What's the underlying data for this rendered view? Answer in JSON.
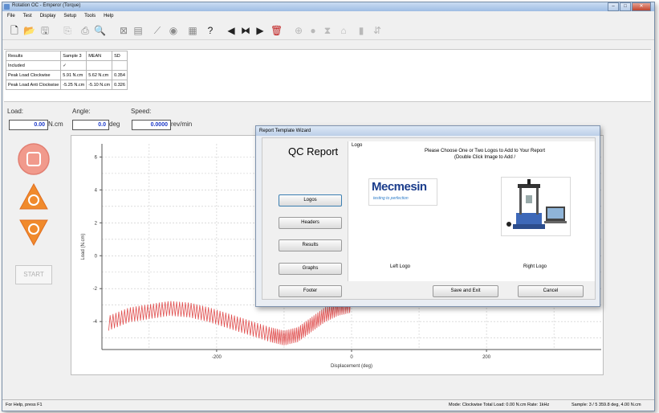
{
  "window": {
    "title": "Rotation OC - Emperor (Torque)",
    "controls": [
      "–",
      "□",
      "✕"
    ]
  },
  "menu": [
    "File",
    "Test",
    "Display",
    "Setup",
    "Tools",
    "Help"
  ],
  "results_table": {
    "headers": [
      "Results",
      "Sample 3",
      "MEAN",
      "SD"
    ],
    "rows": [
      [
        "Included",
        "✓",
        "",
        ""
      ],
      [
        "Peak Load Clockwise",
        "5.91 N.cm",
        "5.62 N.cm",
        "0.354"
      ],
      [
        "Peak Load Anti Clockwise",
        "-5.25 N.cm",
        "-5.10 N.cm",
        "0.326"
      ]
    ]
  },
  "readouts": {
    "load": {
      "label": "Load:",
      "value": "0.00",
      "unit": "N.cm"
    },
    "angle": {
      "label": "Angle:",
      "value": "0.0",
      "unit": "deg"
    },
    "speed": {
      "label": "Speed:",
      "value": "0.0000",
      "unit": "rev/min"
    }
  },
  "controls": {
    "start_label": "START"
  },
  "chart_data": {
    "type": "line",
    "xlabel": "Displacement (deg)",
    "ylabel": "Load (N.cm)",
    "xlim": [
      -370,
      370
    ],
    "ylim": [
      -5.7,
      6.8
    ],
    "xticks": [
      -200,
      0,
      200
    ],
    "yticks": [
      6,
      4,
      2,
      0,
      -2,
      -4
    ],
    "grid": true,
    "series": [
      {
        "color": "#e05050",
        "x": [
          -360,
          -330,
          -300,
          -270,
          -240,
          -210,
          -180,
          -150,
          -120,
          -100,
          -80,
          -60,
          -40,
          -20,
          0
        ],
        "y": [
          -4.1,
          -3.6,
          -3.4,
          -3.2,
          -3.3,
          -3.6,
          -4.0,
          -4.4,
          -4.8,
          -5.0,
          -4.8,
          -4.2,
          -3.6,
          -3.2,
          -3.0
        ]
      }
    ]
  },
  "dialog": {
    "title": "Report Template Wizard",
    "heading": "QC Report",
    "nav": [
      "Logos",
      "Headers",
      "Results",
      "Graphs",
      "Footer"
    ],
    "panel_label": "Logo",
    "instructions": "Please Choose One or Two Logos to Add to Your Report",
    "instructions_sub": "(Double Click Image to Add /",
    "logo_brand": "Mecmesin",
    "logo_tagline": "testing to perfection",
    "left_logo_caption": "Left Logo",
    "right_logo_caption": "Right Logo",
    "save_label": "Save and Exit",
    "cancel_label": "Cancel"
  },
  "status": {
    "help": "For Help, press F1",
    "mode": "Mode: Clockwise   Total Load: 0.00 N.cm   Rate: 1kHz",
    "sample": "Sample: 3 / 5   359.8 deg, 4.00 N.cm"
  }
}
